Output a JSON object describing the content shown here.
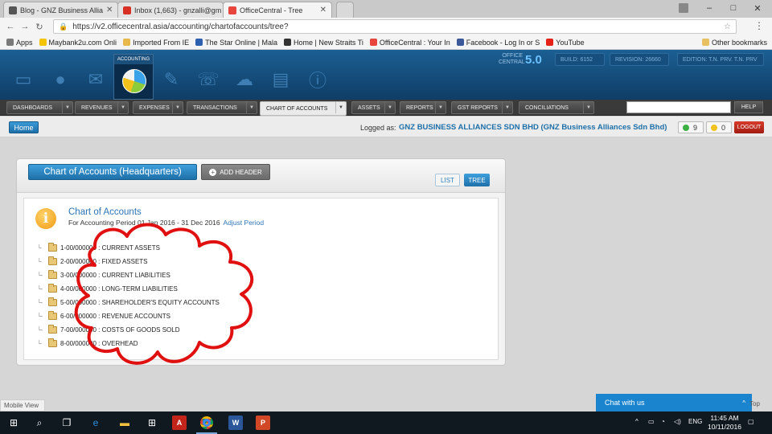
{
  "browser": {
    "tabs": [
      {
        "title": "Blog - GNZ Business Allia",
        "favicon_color": "#555555"
      },
      {
        "title": "Inbox (1,663) - gnzalli@gm",
        "favicon_color": "#d93025"
      },
      {
        "title": "OfficeCentral - Tree",
        "favicon_color": "#e8453c"
      }
    ],
    "url": "https://v2.officecentral.asia/accounting/chartofaccounts/tree?",
    "bookmarks": [
      {
        "label": "Apps",
        "color": "#7a7a7a"
      },
      {
        "label": "Maybank2u.com Onli",
        "color": "#f5c400"
      },
      {
        "label": "Imported From IE",
        "color": "#e8b84a"
      },
      {
        "label": "The Star Online | Mala",
        "color": "#2c5fb0"
      },
      {
        "label": "Home | New Straits Ti",
        "color": "#333333"
      },
      {
        "label": "OfficeCentral : Your In",
        "color": "#e8453c"
      },
      {
        "label": "Facebook - Log In or S",
        "color": "#3b5998"
      },
      {
        "label": "YouTube",
        "color": "#e62117"
      }
    ],
    "other_bookmarks": "Other bookmarks",
    "user_icon": "person-icon",
    "window_controls": {
      "minimize": "–",
      "maximize": "□",
      "close": "✕"
    }
  },
  "app": {
    "active_module": "ACCOUNTING",
    "brand_top": "OFFICE",
    "brand_bottom": "CENTRAL",
    "brand_version": "5.0",
    "build_label": "BUILD: 6152",
    "revision_label": "REVISION: 26660",
    "edition_label": "EDITION: T.N. PRV. T.N. PRV"
  },
  "menu": {
    "items": [
      {
        "label": "DASHBOARDS"
      },
      {
        "label": "REVENUES"
      },
      {
        "label": "EXPENSES"
      },
      {
        "label": "TRANSACTIONS"
      },
      {
        "label": "CHART OF ACCOUNTS"
      },
      {
        "label": "ASSETS"
      },
      {
        "label": "REPORTS"
      },
      {
        "label": "GST REPORTS"
      },
      {
        "label": "CONCILIATIONS"
      }
    ],
    "help": "HELP"
  },
  "status": {
    "home": "Home",
    "logged_as": "Logged as:",
    "company": "GNZ BUSINESS ALLIANCES SDN BHD (GNZ Business Alliances Sdn Bhd)",
    "green_count": "9",
    "alert_count": "0",
    "logout": "LOGOUT",
    "green_color": "#3cb043",
    "alert_color": "#f3c21c"
  },
  "panel": {
    "title": "Chart of Accounts (Headquarters)",
    "add_header": "ADD HEADER",
    "list": "LIST",
    "tree": "TREE",
    "heading": "Chart of Accounts",
    "period": "For Accounting Period 01 Jan 2016 - 31 Dec 2016",
    "adjust": "Adjust Period",
    "accounts": [
      "1-00/000000 : CURRENT ASSETS",
      "2-00/000000 : FIXED ASSETS",
      "3-00/000000 : CURRENT LIABILITIES",
      "4-00/000000 : LONG-TERM LIABILITIES",
      "5-00/000000 : SHAREHOLDER'S EQUITY ACCOUNTS",
      "6-00/000000 : REVENUE ACCOUNTS",
      "7-00/000000 : COSTS OF GOODS SOLD",
      "8-00/000000 : OVERHEAD"
    ]
  },
  "footer": {
    "mobile_view": "Mobile View",
    "chat": "Chat with us",
    "top": "Top"
  },
  "taskbar": {
    "lang": "ENG",
    "time": "11:45 AM",
    "date": "10/11/2016"
  },
  "annotation_color": "#e01010"
}
